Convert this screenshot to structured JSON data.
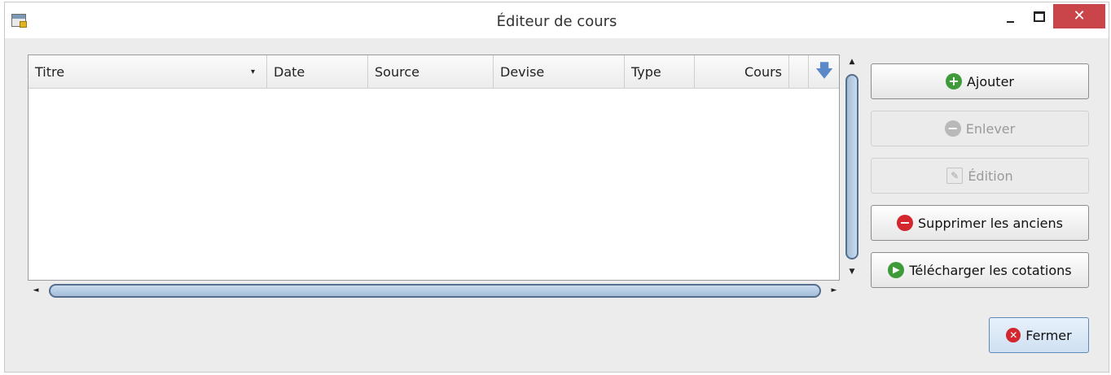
{
  "window": {
    "title": "Éditeur de cours"
  },
  "controls": {
    "minimize": "",
    "maximize": "",
    "close": "✕"
  },
  "grid": {
    "columns": [
      {
        "label": "Titre",
        "has_caret": true
      },
      {
        "label": "Date"
      },
      {
        "label": "Source"
      },
      {
        "label": "Devise"
      },
      {
        "label": "Type"
      },
      {
        "label": "Cours",
        "align": "right"
      }
    ],
    "sort_caret": "▾",
    "column_icon": "arrow-down-icon",
    "rows": []
  },
  "scroll": {
    "up": "▲",
    "down": "▼",
    "left": "◄",
    "right": "►"
  },
  "buttons": {
    "add": "Ajouter",
    "remove": "Enlever",
    "edit": "Édition",
    "purge": "Supprimer les anciens",
    "download": "Télécharger les cotations",
    "close": "Fermer"
  },
  "icons": {
    "add": "+",
    "remove": "−",
    "purge": "−",
    "download": "▶",
    "close": "✕",
    "edit": "✎"
  }
}
